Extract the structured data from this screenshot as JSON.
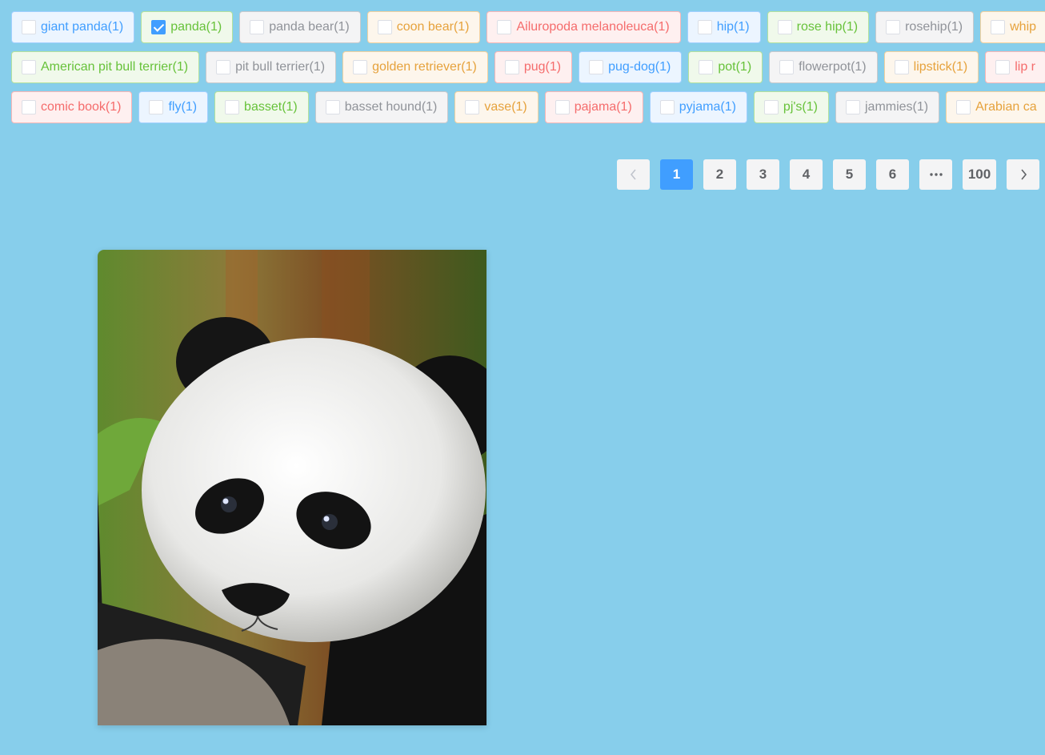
{
  "tag_rows": [
    [
      {
        "label": "giant panda(1)",
        "color": "blue",
        "checked": false
      },
      {
        "label": "panda(1)",
        "color": "green",
        "checked": true
      },
      {
        "label": "panda bear(1)",
        "color": "gray",
        "checked": false
      },
      {
        "label": "coon bear(1)",
        "color": "orange",
        "checked": false
      },
      {
        "label": "Ailuropoda melanoleuca(1)",
        "color": "red",
        "checked": false
      },
      {
        "label": "hip(1)",
        "color": "blue",
        "checked": false
      },
      {
        "label": "rose hip(1)",
        "color": "green",
        "checked": false
      },
      {
        "label": "rosehip(1)",
        "color": "gray",
        "checked": false
      },
      {
        "label": "whip",
        "color": "orange",
        "checked": false
      }
    ],
    [
      {
        "label": "American pit bull terrier(1)",
        "color": "green",
        "checked": false
      },
      {
        "label": "pit bull terrier(1)",
        "color": "gray",
        "checked": false
      },
      {
        "label": "golden retriever(1)",
        "color": "orange",
        "checked": false
      },
      {
        "label": "pug(1)",
        "color": "red",
        "checked": false
      },
      {
        "label": "pug-dog(1)",
        "color": "blue",
        "checked": false
      },
      {
        "label": "pot(1)",
        "color": "green",
        "checked": false
      },
      {
        "label": "flowerpot(1)",
        "color": "gray",
        "checked": false
      },
      {
        "label": "lipstick(1)",
        "color": "orange",
        "checked": false
      },
      {
        "label": "lip r",
        "color": "red",
        "checked": false
      }
    ],
    [
      {
        "label": "comic book(1)",
        "color": "red",
        "checked": false
      },
      {
        "label": "fly(1)",
        "color": "blue",
        "checked": false
      },
      {
        "label": "basset(1)",
        "color": "green",
        "checked": false
      },
      {
        "label": "basset hound(1)",
        "color": "gray",
        "checked": false
      },
      {
        "label": "vase(1)",
        "color": "orange",
        "checked": false
      },
      {
        "label": "pajama(1)",
        "color": "red",
        "checked": false
      },
      {
        "label": "pyjama(1)",
        "color": "blue",
        "checked": false
      },
      {
        "label": "pj's(1)",
        "color": "green",
        "checked": false
      },
      {
        "label": "jammies(1)",
        "color": "gray",
        "checked": false
      },
      {
        "label": "Arabian ca",
        "color": "orange",
        "checked": false
      }
    ]
  ],
  "pagination": {
    "pages": [
      "1",
      "2",
      "3",
      "4",
      "5",
      "6"
    ],
    "more_icon": "more-dots-icon",
    "last_page": "100",
    "current": "1",
    "prev_icon": "chevron-left-icon",
    "next_icon": "chevron-right-icon"
  },
  "colors": {
    "page_background": "#87CEEB",
    "primary": "#409eff"
  }
}
